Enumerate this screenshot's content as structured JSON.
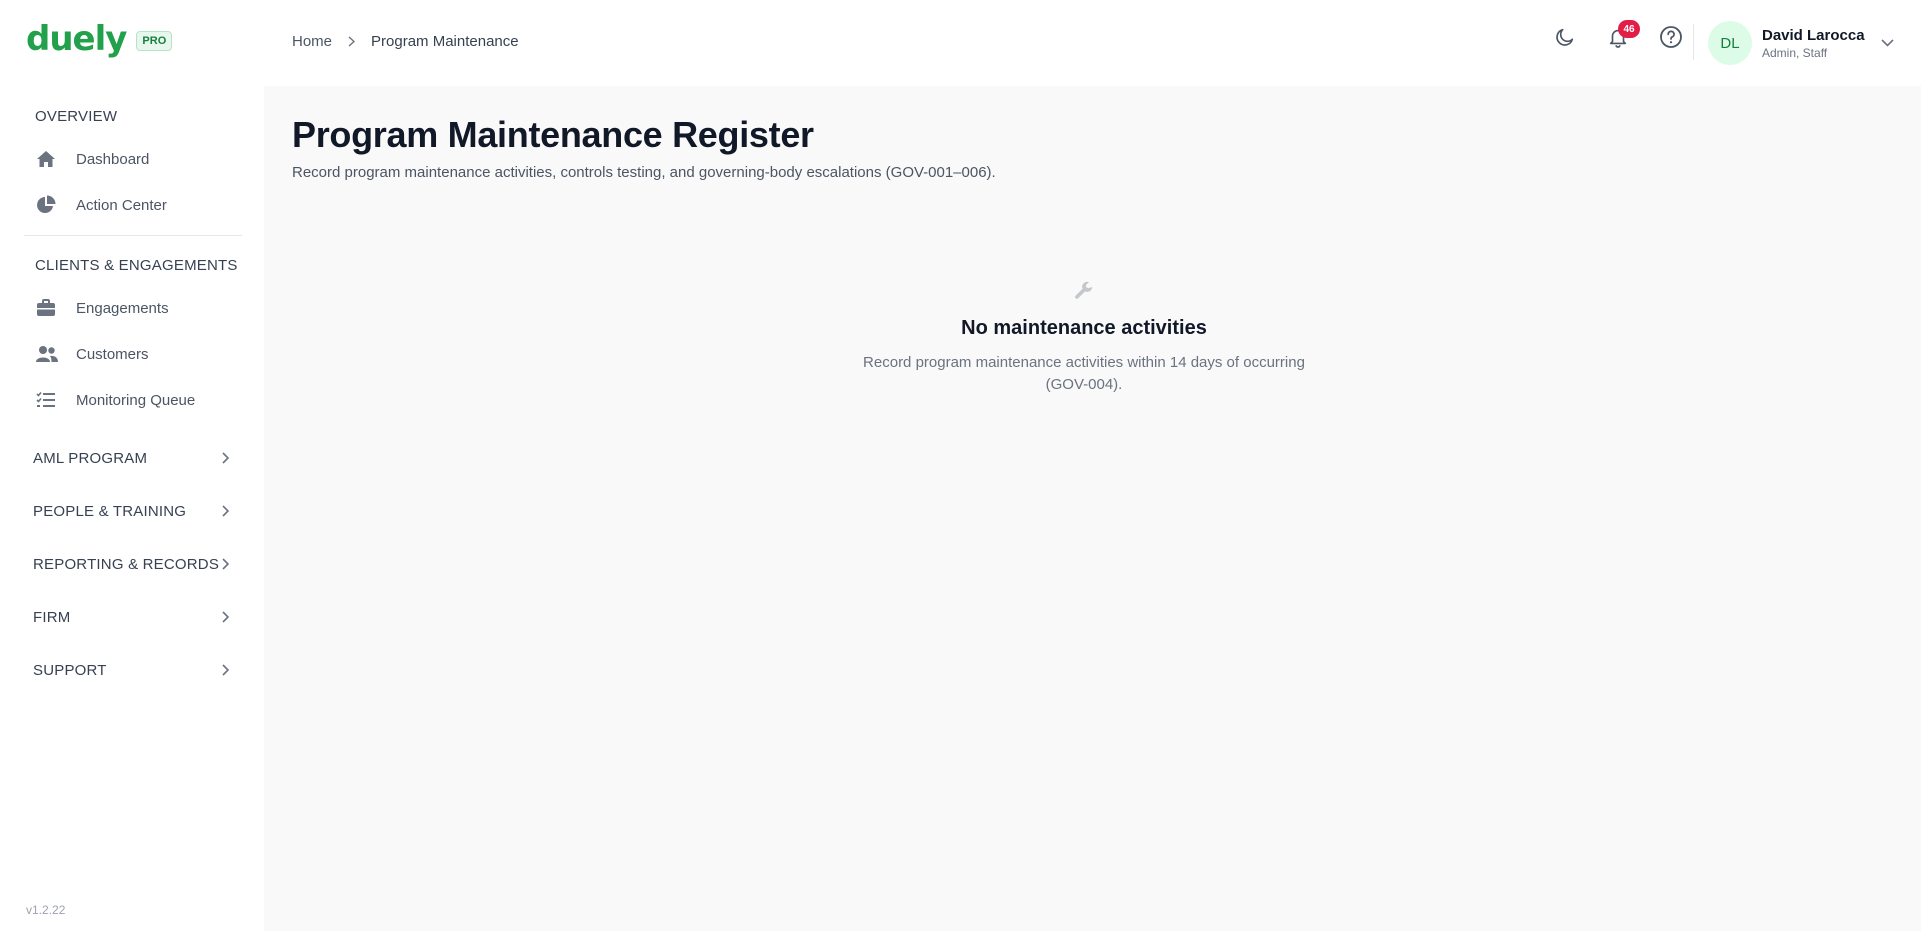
{
  "brand": {
    "logo": "duely",
    "badge": "PRO"
  },
  "sidebar": {
    "sections": [
      {
        "title": "OVERVIEW",
        "items": [
          {
            "label": "Dashboard",
            "icon": "home-icon"
          },
          {
            "label": "Action Center",
            "icon": "pie-chart-icon"
          }
        ]
      },
      {
        "title": "CLIENTS & ENGAGEMENTS",
        "items": [
          {
            "label": "Engagements",
            "icon": "briefcase-icon"
          },
          {
            "label": "Customers",
            "icon": "users-icon"
          },
          {
            "label": "Monitoring Queue",
            "icon": "checklist-icon"
          }
        ]
      }
    ],
    "groups": [
      {
        "label": "AML PROGRAM"
      },
      {
        "label": "PEOPLE & TRAINING"
      },
      {
        "label": "REPORTING & RECORDS"
      },
      {
        "label": "FIRM"
      },
      {
        "label": "SUPPORT"
      }
    ],
    "version": "v1.2.22"
  },
  "header": {
    "breadcrumb": {
      "home": "Home",
      "current": "Program Maintenance"
    },
    "notifications_count": "46",
    "user": {
      "initials": "DL",
      "name": "David Larocca",
      "role": "Admin, Staff"
    }
  },
  "main": {
    "title": "Program Maintenance Register",
    "subtitle": "Record program maintenance activities, controls testing, and governing-body escalations (GOV-001–006).",
    "empty_state": {
      "icon": "wrench-icon",
      "title": "No maintenance activities",
      "text": "Record program maintenance activities within 14 days of occurring (GOV-004)."
    }
  },
  "colors": {
    "brand": "#22a04b",
    "badge_red": "#e11d48",
    "main_bg": "#f9f9f9",
    "avatar_bg": "#dcfce7"
  }
}
